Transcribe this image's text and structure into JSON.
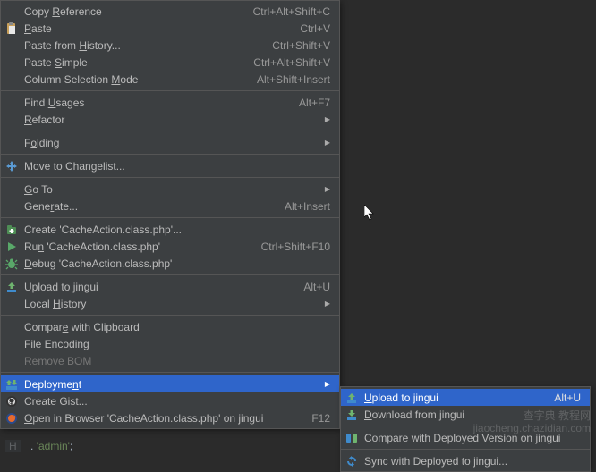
{
  "main_menu": [
    {
      "type": "item",
      "icon": "",
      "label": "Copy <u>R</u>eference",
      "shortcut": "Ctrl+Alt+Shift+C"
    },
    {
      "type": "item",
      "icon": "paste",
      "label": "<u>P</u>aste",
      "shortcut": "Ctrl+V"
    },
    {
      "type": "item",
      "icon": "",
      "label": "Paste from <u>H</u>istory...",
      "shortcut": "Ctrl+Shift+V"
    },
    {
      "type": "item",
      "icon": "",
      "label": "Paste <u>S</u>imple",
      "shortcut": "Ctrl+Alt+Shift+V"
    },
    {
      "type": "item",
      "icon": "",
      "label": "Column Selection <u>M</u>ode",
      "shortcut": "Alt+Shift+Insert"
    },
    {
      "type": "sep"
    },
    {
      "type": "item",
      "icon": "",
      "label": "Find <u>U</u>sages",
      "shortcut": "Alt+F7"
    },
    {
      "type": "item",
      "icon": "",
      "label": "<u>R</u>efactor",
      "submenu": true
    },
    {
      "type": "sep"
    },
    {
      "type": "item",
      "icon": "",
      "label": "F<u>o</u>lding",
      "submenu": true
    },
    {
      "type": "sep"
    },
    {
      "type": "item",
      "icon": "move",
      "label": "Move to Changelist..."
    },
    {
      "type": "sep"
    },
    {
      "type": "item",
      "icon": "",
      "label": "<u>G</u>o To",
      "submenu": true
    },
    {
      "type": "item",
      "icon": "",
      "label": "Gene<u>r</u>ate...",
      "shortcut": "Alt+Insert"
    },
    {
      "type": "sep"
    },
    {
      "type": "item",
      "icon": "create",
      "label": "Create 'CacheAction.class.php'..."
    },
    {
      "type": "item",
      "icon": "run",
      "label": "Ru<u>n</u> 'CacheAction.class.php'",
      "shortcut": "Ctrl+Shift+F10"
    },
    {
      "type": "item",
      "icon": "debug",
      "label": "<u>D</u>ebug 'CacheAction.class.php'"
    },
    {
      "type": "sep"
    },
    {
      "type": "item",
      "icon": "upload",
      "label": "Upload to jingui",
      "shortcut": "Alt+U"
    },
    {
      "type": "item",
      "icon": "",
      "label": "Local <u>H</u>istory",
      "submenu": true
    },
    {
      "type": "sep"
    },
    {
      "type": "item",
      "icon": "",
      "label": "Compar<u>e</u> with Clipboard"
    },
    {
      "type": "item",
      "icon": "",
      "label": "File Encoding"
    },
    {
      "type": "item",
      "icon": "",
      "label": "Remove BOM",
      "disabled": true
    },
    {
      "type": "sep"
    },
    {
      "type": "item",
      "icon": "deploy",
      "label": "Deployme<u>n</u>t",
      "submenu": true,
      "highlighted": true
    },
    {
      "type": "item",
      "icon": "gist",
      "label": "Create Gist..."
    },
    {
      "type": "item",
      "icon": "ff",
      "label": "<u>O</u>pen in Browser 'CacheAction.class.php' on jingui",
      "shortcut": "F12"
    }
  ],
  "sub_menu": [
    {
      "type": "item",
      "icon": "upload",
      "label": "<u>U</u>pload to jingui",
      "shortcut": "Alt+U",
      "highlighted": true
    },
    {
      "type": "item",
      "icon": "download",
      "label": "<u>D</u>ownload from jingui"
    },
    {
      "type": "sep"
    },
    {
      "type": "item",
      "icon": "compare",
      "label": "Compare with Deployed Version on jingui"
    },
    {
      "type": "sep"
    },
    {
      "type": "item",
      "icon": "sync",
      "label": "Sync with Deployed to jingui..."
    }
  ],
  "code_snippet": {
    "gutter": "H",
    "dot": " . ",
    "string": "'admin'",
    "semi": ";"
  },
  "watermark": {
    "line1": "查字典 教程网",
    "line2": "jiaocheng.chazidian.com"
  }
}
